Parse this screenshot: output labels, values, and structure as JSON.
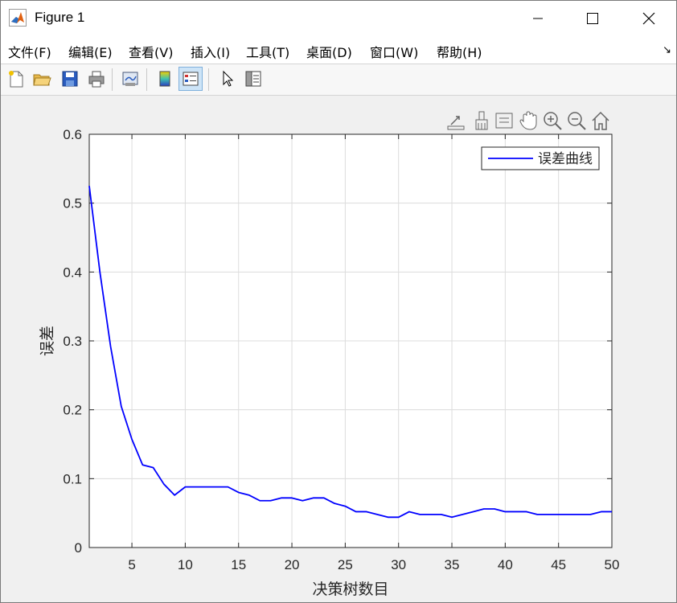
{
  "window": {
    "title": "Figure 1"
  },
  "menu": [
    {
      "id": "file",
      "label": "文件(F)"
    },
    {
      "id": "edit",
      "label": "编辑(E)"
    },
    {
      "id": "view",
      "label": "查看(V)"
    },
    {
      "id": "insert",
      "label": "插入(I)"
    },
    {
      "id": "tools",
      "label": "工具(T)"
    },
    {
      "id": "desktop",
      "label": "桌面(D)"
    },
    {
      "id": "window",
      "label": "窗口(W)"
    },
    {
      "id": "help",
      "label": "帮助(H)"
    }
  ],
  "toolbar_icons": [
    "new-figure-icon",
    "open-file-icon",
    "save-icon",
    "print-icon",
    "link-plot-icon",
    "colorbar-icon",
    "legend-icon",
    "edit-plot-icon",
    "property-inspector-icon"
  ],
  "axes_toolbar_icons": [
    "export-icon",
    "brush-icon",
    "data-tips-icon",
    "pan-icon",
    "zoom-in-icon",
    "zoom-out-icon",
    "home-icon"
  ],
  "colors": {
    "line": "#0000ff",
    "grid": "#dcdcdc",
    "axes_bg": "#ffffff",
    "figure_bg": "#f0f0f0"
  },
  "chart_data": {
    "type": "line",
    "xlabel": "决策树数目",
    "ylabel": "误差",
    "xlim": [
      1,
      50
    ],
    "ylim": [
      0,
      0.6
    ],
    "xticks": [
      5,
      10,
      15,
      20,
      25,
      30,
      35,
      40,
      45,
      50
    ],
    "yticks": [
      0,
      0.1,
      0.2,
      0.3,
      0.4,
      0.5,
      0.6
    ],
    "grid": true,
    "legend_position": "top-right",
    "series": [
      {
        "name": "误差曲线",
        "color": "#0000ff",
        "x": [
          1,
          2,
          3,
          4,
          5,
          6,
          7,
          8,
          9,
          10,
          11,
          12,
          13,
          14,
          15,
          16,
          17,
          18,
          19,
          20,
          21,
          22,
          23,
          24,
          25,
          26,
          27,
          28,
          29,
          30,
          31,
          32,
          33,
          34,
          35,
          36,
          37,
          38,
          39,
          40,
          41,
          42,
          43,
          44,
          45,
          46,
          47,
          48,
          49,
          50
        ],
        "y": [
          0.525,
          0.4,
          0.292,
          0.205,
          0.157,
          0.12,
          0.116,
          0.092,
          0.076,
          0.088,
          0.088,
          0.088,
          0.088,
          0.088,
          0.08,
          0.076,
          0.068,
          0.068,
          0.072,
          0.072,
          0.068,
          0.072,
          0.072,
          0.064,
          0.06,
          0.052,
          0.052,
          0.048,
          0.044,
          0.044,
          0.052,
          0.048,
          0.048,
          0.048,
          0.044,
          0.048,
          0.052,
          0.056,
          0.056,
          0.052,
          0.052,
          0.052,
          0.048,
          0.048,
          0.048,
          0.048,
          0.048,
          0.048,
          0.052,
          0.052
        ]
      }
    ]
  }
}
